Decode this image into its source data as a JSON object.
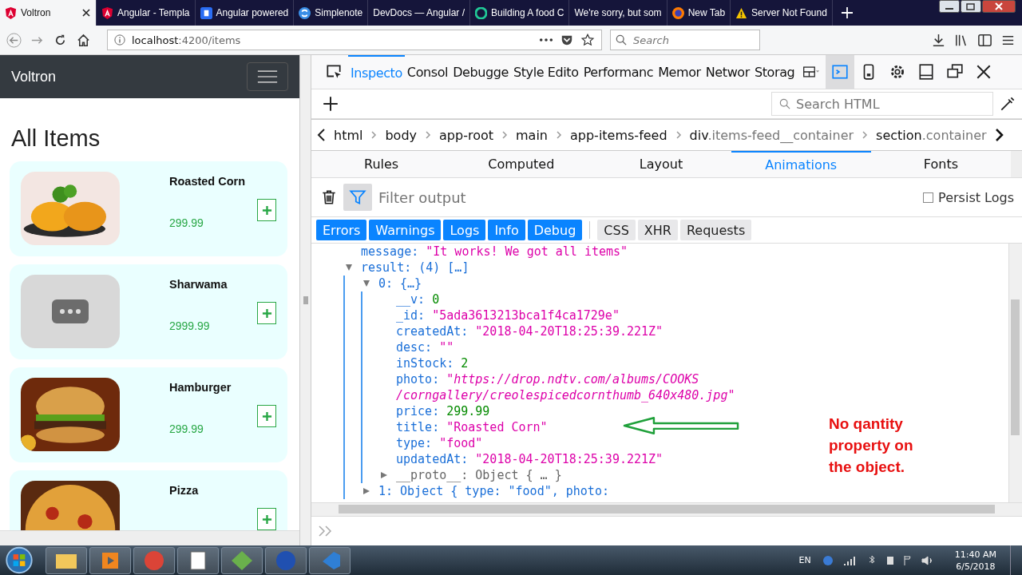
{
  "browser_tabs": [
    {
      "label": "Voltron",
      "selected": true,
      "kind": "shield"
    },
    {
      "label": "Angular - Templa",
      "selected": false,
      "kind": "shield"
    },
    {
      "label": "Angular powered",
      "selected": false,
      "kind": "square"
    },
    {
      "label": "Simplenote",
      "selected": false,
      "kind": "circle"
    },
    {
      "label": "DevDocs — Angular /",
      "selected": false,
      "kind": "plain"
    },
    {
      "label": "Building A food C",
      "selected": false,
      "kind": "ring"
    },
    {
      "label": "We're sorry, but som",
      "selected": false,
      "kind": "plain"
    },
    {
      "label": "New Tab",
      "selected": false,
      "kind": "globe"
    },
    {
      "label": "Server Not Found",
      "selected": false,
      "kind": "warning"
    }
  ],
  "address": {
    "host": "localhost",
    "path": ":4200/items"
  },
  "search": {
    "placeholder": "Search"
  },
  "app": {
    "brand": "Voltron",
    "heading": "All Items",
    "items": [
      {
        "title": "Roasted Corn",
        "price": "299.99",
        "kind": "picture"
      },
      {
        "title": "Sharwama",
        "price": "2999.99",
        "kind": "placeholder"
      },
      {
        "title": "Hamburger",
        "price": "299.99",
        "kind": "picture"
      },
      {
        "title": "Pizza",
        "kind": "picture"
      }
    ]
  },
  "devtools": {
    "tabs": [
      {
        "label": "Inspecto",
        "selected": true
      },
      {
        "label": "Consol",
        "selected": false
      },
      {
        "label": "Debugge",
        "selected": false
      },
      {
        "label": "Style Edito",
        "selected": false
      },
      {
        "label": "Performanc",
        "selected": false
      },
      {
        "label": "Memor",
        "selected": false
      },
      {
        "label": "Networ",
        "selected": false
      },
      {
        "label": "Storag",
        "selected": false
      }
    ],
    "search_placeholder": "Search HTML",
    "breadcrumbs": [
      {
        "tag": "html"
      },
      {
        "tag": "body"
      },
      {
        "tag": "app-root"
      },
      {
        "tag": "main"
      },
      {
        "tag": "app-items-feed"
      },
      {
        "tag": "div",
        "cls": ".items-feed__container"
      },
      {
        "tag": "section",
        "cls": ".container"
      }
    ],
    "side_tabs": [
      {
        "label": "Rules",
        "selected": false
      },
      {
        "label": "Computed",
        "selected": false
      },
      {
        "label": "Layout",
        "selected": false
      },
      {
        "label": "Animations",
        "selected": true
      },
      {
        "label": "Fonts",
        "selected": false
      }
    ],
    "filter_placeholder": "Filter output",
    "persist_logs": {
      "label": "Persist Logs",
      "checked": false
    },
    "filters": [
      {
        "label": "Errors",
        "selected": true
      },
      {
        "label": "Warnings",
        "selected": true
      },
      {
        "label": "Logs",
        "selected": true
      },
      {
        "label": "Info",
        "selected": true
      },
      {
        "label": "Debug",
        "selected": true
      },
      {
        "label": "CSS",
        "selected": false
      },
      {
        "label": "XHR",
        "selected": false
      },
      {
        "label": "Requests",
        "selected": false
      }
    ],
    "console": [
      {
        "key": "message:",
        "value": "\"It works! We got all items\"",
        "kind": "string"
      },
      {
        "key": "result:",
        "value": "(4) […]",
        "kind": "object",
        "expanded": true,
        "children": [
          {
            "key": "0:",
            "value": "{…}",
            "kind": "object",
            "expanded": true,
            "children": [
              {
                "key": "__v:",
                "value": "0",
                "kind": "number"
              },
              {
                "key": "_id:",
                "value": "\"5ada3613213bca1f4ca1729e\"",
                "kind": "string"
              },
              {
                "key": "createdAt:",
                "value": "\"2018-04-20T18:25:39.221Z\"",
                "kind": "string"
              },
              {
                "key": "desc:",
                "value": "\"\"",
                "kind": "string"
              },
              {
                "key": "inStock:",
                "value": "2",
                "kind": "number"
              },
              {
                "key": "photo:",
                "value": "\"https://drop.ndtv.com/albums/COOKS",
                "kind": "url"
              },
              {
                "value": "/corngallery/creolespicedcornthumb_640x480.jpg\"",
                "kind": "url"
              },
              {
                "key": "price:",
                "value": "299.99",
                "kind": "number"
              },
              {
                "key": "title:",
                "value": "\"Roasted Corn\"",
                "kind": "string"
              },
              {
                "key": "type:",
                "value": "\"food\"",
                "kind": "string"
              },
              {
                "key": "updatedAt:",
                "value": "\"2018-04-20T18:25:39.221Z\"",
                "kind": "string"
              },
              {
                "key": "__proto__:",
                "value": "Object { … }",
                "kind": "proto",
                "expanded": false
              }
            ]
          },
          {
            "key": "1:",
            "value": "Object { type: \"food\", photo:",
            "kind": "object",
            "expanded": false
          }
        ]
      }
    ],
    "annotation": "No qantity property on the object."
  },
  "taskbar": {
    "language": "EN",
    "time": "11:40 AM",
    "date": "6/5/2018"
  }
}
